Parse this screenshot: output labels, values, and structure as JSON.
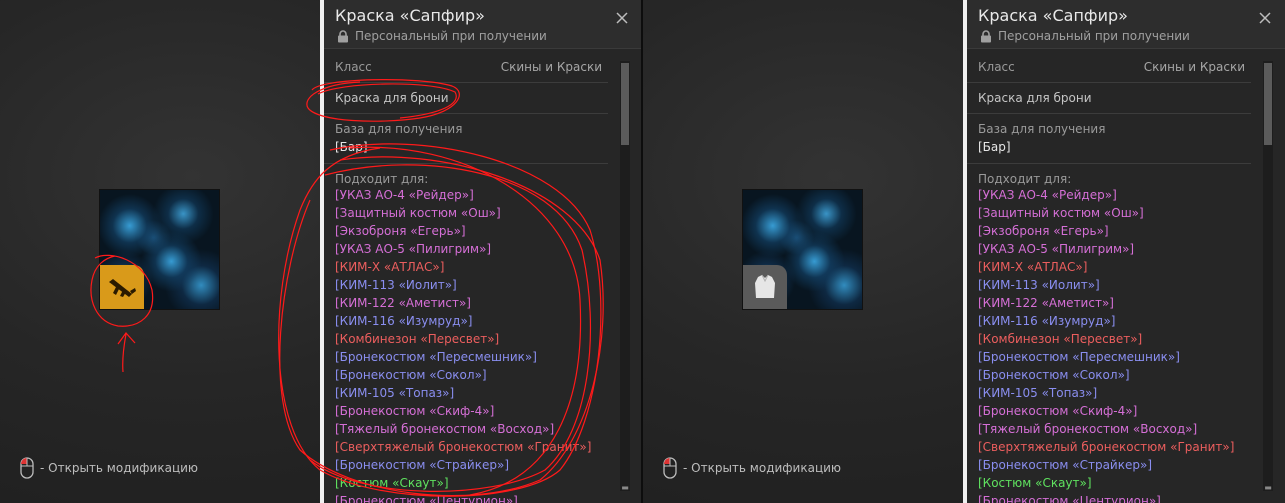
{
  "tooltip": {
    "title": "Краска «Сапфир»",
    "subtitle": "Персональный при получении",
    "class_label": "Класс",
    "class_value": "Скины и Краски",
    "type_value": "Краска для брони",
    "base_label": "База для получения",
    "base_value": "[Бар]",
    "fits_label": "Подходит для:",
    "fits_items": [
      {
        "text": "[УКАЗ АО-4 «Рейдер»]",
        "color": "#d56fd6"
      },
      {
        "text": "[Защитный костюм «Ош»]",
        "color": "#d56fd6"
      },
      {
        "text": "[Экзоброня «Егерь»]",
        "color": "#d56fd6"
      },
      {
        "text": "[УКАЗ АО-5 «Пилигрим»]",
        "color": "#d56fd6"
      },
      {
        "text": "[КИМ-Х «АТЛАС»]",
        "color": "#ec5e5e"
      },
      {
        "text": "[КИМ-113 «Иолит»]",
        "color": "#8a8ef0"
      },
      {
        "text": "[КИМ-122 «Аметист»]",
        "color": "#d56fd6"
      },
      {
        "text": "[КИМ-116 «Изумруд»]",
        "color": "#8a8ef0"
      },
      {
        "text": "[Комбинезон «Пересвет»]",
        "color": "#ec5e5e"
      },
      {
        "text": "[Бронекостюм «Пересмешник»]",
        "color": "#8a8ef0"
      },
      {
        "text": "[Бронекостюм «Сокол»]",
        "color": "#8a8ef0"
      },
      {
        "text": "[КИМ-105 «Топаз»]",
        "color": "#8a8ef0"
      },
      {
        "text": "[Бронекостюм «Скиф-4»]",
        "color": "#d56fd6"
      },
      {
        "text": "[Тяжелый бронекостюм «Восход»]",
        "color": "#d56fd6"
      },
      {
        "text": "[Сверхтяжелый бронекостюм «Гранит»]",
        "color": "#ec5e5e"
      },
      {
        "text": "[Бронекостюм «Страйкер»]",
        "color": "#8a8ef0"
      },
      {
        "text": "[Костюм «Скаут»]",
        "color": "#5fe25f"
      },
      {
        "text": "[Бронекостюм «Центурион»]",
        "color": "#d56fd6"
      }
    ]
  },
  "hint": {
    "open_mod": "- Открыть модификацию"
  },
  "icons": {
    "left_badge": "rifle-icon",
    "right_badge": "armor-icon",
    "lock": "lock-icon",
    "close": "close-icon",
    "mouse": "mouse-icon"
  },
  "colors": {
    "annotation": "#ff1a1a",
    "gun_badge": "#d99a1a",
    "armor_badge": "#5a5a5a"
  }
}
